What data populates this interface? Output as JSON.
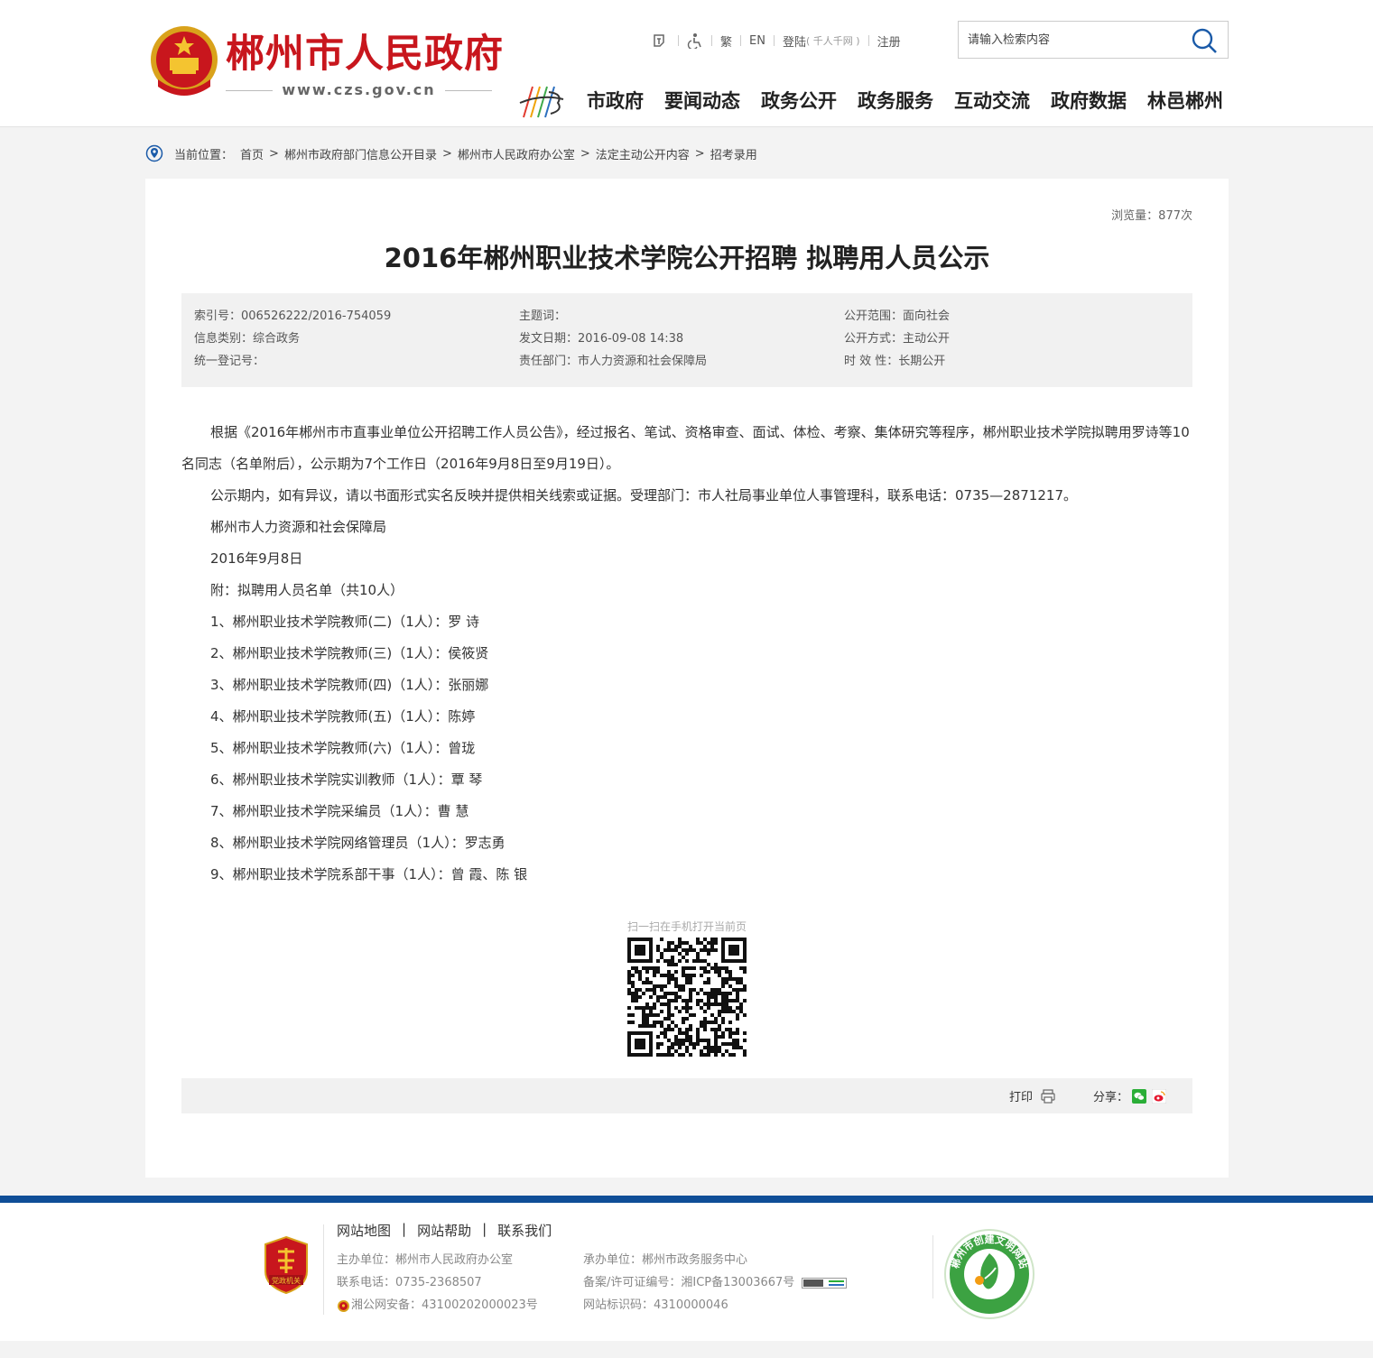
{
  "header": {
    "site_name": "郴州市人民政府",
    "site_url": "www.czs.gov.cn",
    "toplinks": {
      "traditional": "繁",
      "english": "EN",
      "login": "登陆",
      "login_sub": "( 千人千网 )",
      "register": "注册"
    },
    "search": {
      "placeholder": "请输入检索内容"
    },
    "nav": [
      "市政府",
      "要闻动态",
      "政务公开",
      "政务服务",
      "互动交流",
      "政府数据",
      "林邑郴州"
    ]
  },
  "breadcrumb": {
    "label": "当前位置：",
    "items": [
      "首页",
      "郴州市政府部门信息公开目录",
      "郴州市人民政府办公室",
      "法定主动公开内容",
      "招考录用"
    ]
  },
  "article": {
    "views": "浏览量：877次",
    "title": "2016年郴州职业技术学院公开招聘 拟聘用人员公示",
    "meta": {
      "index_no": "索引号：006526222/2016-754059",
      "info_type": "信息类别：综合政务",
      "reg_no": "统一登记号：",
      "keywords": "主题词：",
      "date": "发文日期：2016-09-08 14:38",
      "dept": "责任部门：市人力资源和社会保障局",
      "scope": "公开范围：面向社会",
      "method": "公开方式：主动公开",
      "validity": "时 效 性：长期公开"
    },
    "paragraphs": [
      "根据《2016年郴州市市直事业单位公开招聘工作人员公告》，经过报名、笔试、资格审查、面试、体检、考察、集体研究等程序，郴州职业技术学院拟聘用罗诗等10名同志（名单附后），公示期为7个工作日（2016年9月8日至9月19日）。",
      "公示期内，如有异议，请以书面形式实名反映并提供相关线索或证据。受理部门：市人社局事业单位人事管理科，联系电话：0735—2871217。",
      "郴州市人力资源和社会保障局",
      "2016年9月8日",
      "附：拟聘用人员名单（共10人）",
      "1、郴州职业技术学院教师(二)（1人）：罗 诗",
      "2、郴州职业技术学院教师(三)（1人）：侯筱贤",
      "3、郴州职业技术学院教师(四)（1人）：张丽娜",
      "4、郴州职业技术学院教师(五)（1人）：陈婷",
      "5、郴州职业技术学院教师(六)（1人）：曾珑",
      "6、郴州职业技术学院实训教师（1人）：覃 琴",
      "7、郴州职业技术学院采编员（1人）：曹 慧",
      "8、郴州职业技术学院网络管理员（1人）：罗志勇",
      "9、郴州职业技术学院系部干事（1人）：曾 霞、陈 银"
    ],
    "qr_caption": "扫一扫在手机打开当前页",
    "print": "打印",
    "share": "分享："
  },
  "footer": {
    "links": [
      "网站地图",
      "网站帮助",
      "联系我们"
    ],
    "sponsor": "主办单位：郴州市人民政府办公室",
    "phone": "联系电话：0735-2368507",
    "police": "湘公网安备：43100202000023号",
    "organizer": "承办单位：郴州市政务服务中心",
    "icp": "备案/许可证编号：湘ICP备13003667号",
    "site_id": "网站标识码：4310000046",
    "badge_text": "党政机关",
    "wenming_text": "郴州市创建文明网站"
  },
  "colors": {
    "brand_red": "#c8161d",
    "footer_blue": "#0f4e97"
  }
}
